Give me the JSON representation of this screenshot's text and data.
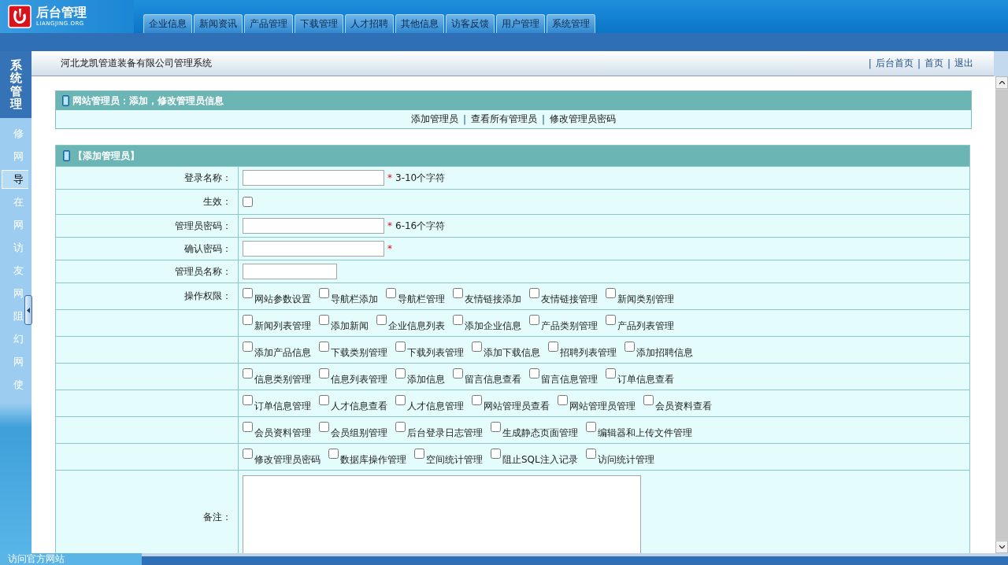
{
  "header": {
    "logo": {
      "title": "后台管理",
      "subtitle": "LIANGJING.ORG"
    },
    "tabs": [
      {
        "label": "企业信息"
      },
      {
        "label": "新闻资讯"
      },
      {
        "label": "产品管理"
      },
      {
        "label": "下载管理"
      },
      {
        "label": "人才招聘"
      },
      {
        "label": "其他信息"
      },
      {
        "label": "访客反馈"
      },
      {
        "label": "用户管理"
      },
      {
        "label": "系统管理"
      }
    ]
  },
  "sidebar": {
    "title": "系统管理",
    "items": [
      {
        "label": "修",
        "selected": false
      },
      {
        "label": "网",
        "selected": false
      },
      {
        "label": "导",
        "selected": true
      },
      {
        "label": "在",
        "selected": false
      },
      {
        "label": "网",
        "selected": false
      },
      {
        "label": "访",
        "selected": false
      },
      {
        "label": "友",
        "selected": false
      },
      {
        "label": "网",
        "selected": false
      },
      {
        "label": "阻",
        "selected": false
      },
      {
        "label": "幻",
        "selected": false
      },
      {
        "label": "网",
        "selected": false
      },
      {
        "label": "使",
        "selected": false
      }
    ],
    "footer_link": "访问官方网站"
  },
  "panel": {
    "title": "河北龙凯管道装备有限公司管理系统",
    "links": [
      {
        "sep": "|",
        "label": "后台首页"
      },
      {
        "sep": "|",
        "label": "首页"
      },
      {
        "sep": "|",
        "label": "退出"
      }
    ]
  },
  "section": {
    "title": "网站管理员：添加，修改管理员信息",
    "links": [
      {
        "label": "添加管理员"
      },
      {
        "sep": "|",
        "label": "查看所有管理员"
      },
      {
        "sep": "|",
        "label": "修改管理员密码"
      }
    ]
  },
  "form": {
    "title": "【添加管理员】",
    "fields": [
      {
        "kind": "text",
        "label": "登录名称：",
        "mark": "*",
        "hint": "3-10个字符"
      },
      {
        "kind": "checkbox",
        "label": "生效：",
        "checked": false
      },
      {
        "kind": "text",
        "label": "管理员密码：",
        "mark": "*",
        "hint": "6-16个字符"
      },
      {
        "kind": "text",
        "label": "确认密码：",
        "mark": "*"
      },
      {
        "kind": "short_text",
        "label": "管理员名称："
      }
    ],
    "permissions": {
      "label": "操作权限：",
      "rows": [
        [
          {
            "label": "网站参数设置",
            "checked": false
          },
          {
            "label": "导航栏添加",
            "checked": false
          },
          {
            "label": "导航栏管理",
            "checked": false
          },
          {
            "label": "友情链接添加",
            "checked": false
          },
          {
            "label": "友情链接管理",
            "checked": false
          },
          {
            "label": "新闻类别管理",
            "checked": false
          }
        ],
        [
          {
            "label": "新闻列表管理",
            "checked": false
          },
          {
            "label": "添加新闻",
            "checked": false
          },
          {
            "label": "企业信息列表",
            "checked": false
          },
          {
            "label": "添加企业信息",
            "checked": false
          },
          {
            "label": "产品类别管理",
            "checked": false
          },
          {
            "label": "产品列表管理",
            "checked": false
          }
        ],
        [
          {
            "label": "添加产品信息",
            "checked": false
          },
          {
            "label": "下载类别管理",
            "checked": false
          },
          {
            "label": "下载列表管理",
            "checked": false
          },
          {
            "label": "添加下载信息",
            "checked": false
          },
          {
            "label": "招聘列表管理",
            "checked": false
          },
          {
            "label": "添加招聘信息",
            "checked": false
          }
        ],
        [
          {
            "label": "信息类别管理",
            "checked": false
          },
          {
            "label": "信息列表管理",
            "checked": false
          },
          {
            "label": "添加信息",
            "checked": false
          },
          {
            "label": "留言信息查看",
            "checked": false
          },
          {
            "label": "留言信息管理",
            "checked": false
          },
          {
            "label": "订单信息查看",
            "checked": false
          }
        ],
        [
          {
            "label": "订单信息管理",
            "checked": false
          },
          {
            "label": "人才信息查看",
            "checked": false
          },
          {
            "label": "人才信息管理",
            "checked": false
          },
          {
            "label": "网站管理员查看",
            "checked": false
          },
          {
            "label": "网站管理员管理",
            "checked": false
          },
          {
            "label": "会员资料查看",
            "checked": false
          }
        ],
        [
          {
            "label": "会员资料管理",
            "checked": false
          },
          {
            "label": "会员组别管理",
            "checked": false
          },
          {
            "label": "后台登录日志管理",
            "checked": false
          },
          {
            "label": "生成静态页面管理",
            "checked": false
          },
          {
            "label": "编辑器和上传文件管理",
            "checked": false
          }
        ],
        [
          {
            "label": "修改管理员密码",
            "checked": false
          },
          {
            "label": "数据库操作管理",
            "checked": false
          },
          {
            "label": "空间统计管理",
            "checked": false
          },
          {
            "label": "阻止SQL注入记录",
            "checked": false
          },
          {
            "label": "访问统计管理",
            "checked": false
          }
        ]
      ]
    },
    "remark": {
      "label": "备注："
    }
  }
}
